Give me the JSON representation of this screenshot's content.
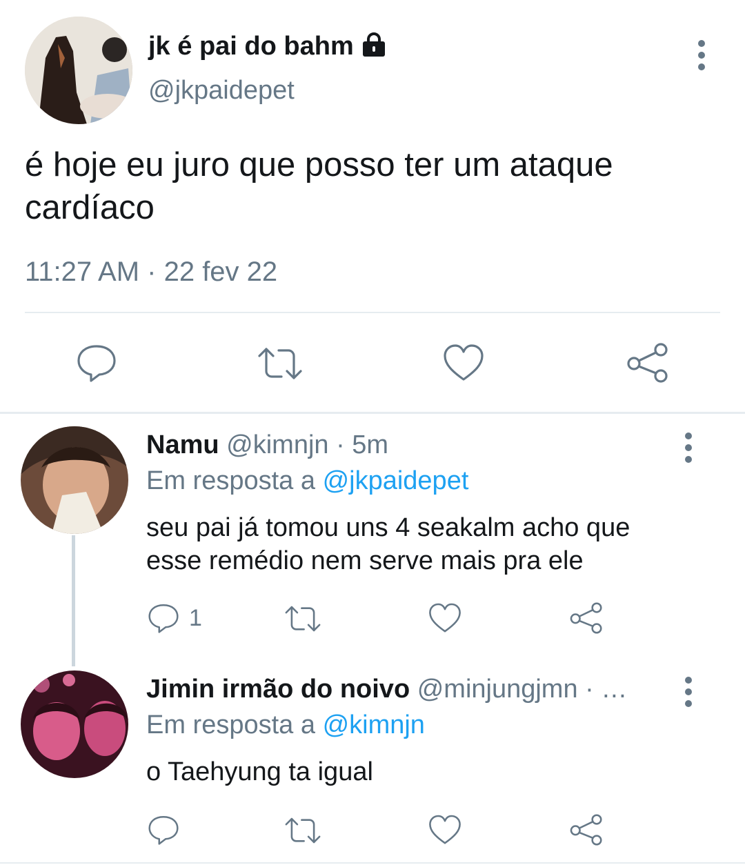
{
  "main_tweet": {
    "display_name": "jk é pai do bahm",
    "handle": "@jkpaidepet",
    "text_line1": "é hoje eu juro que posso ter um ataque",
    "text_line2": "cardíaco",
    "timestamp": "11:27 AM · 22 fev 22",
    "protected_icon": "lock-icon"
  },
  "replies": [
    {
      "display_name": "Namu",
      "meta": "@kimnjn · 5m",
      "reply_prefix": "Em resposta a",
      "reply_to": "@jkpaidepet",
      "text_line1": "seu pai já tomou uns 4 seakalm acho que",
      "text_line2": "esse remédio nem serve mais pra ele",
      "reply_count": "1"
    },
    {
      "display_name": "Jimin irmão do noivo",
      "meta": "@minjungjmn · …",
      "reply_prefix": "Em resposta a",
      "reply_to": "@kimnjn",
      "text_line1": "o Taehyung ta igual",
      "reply_count": ""
    }
  ],
  "colors": {
    "text": "#14171a",
    "secondary": "#657786",
    "link": "#1da1f2",
    "divider": "#e6ecf0"
  }
}
